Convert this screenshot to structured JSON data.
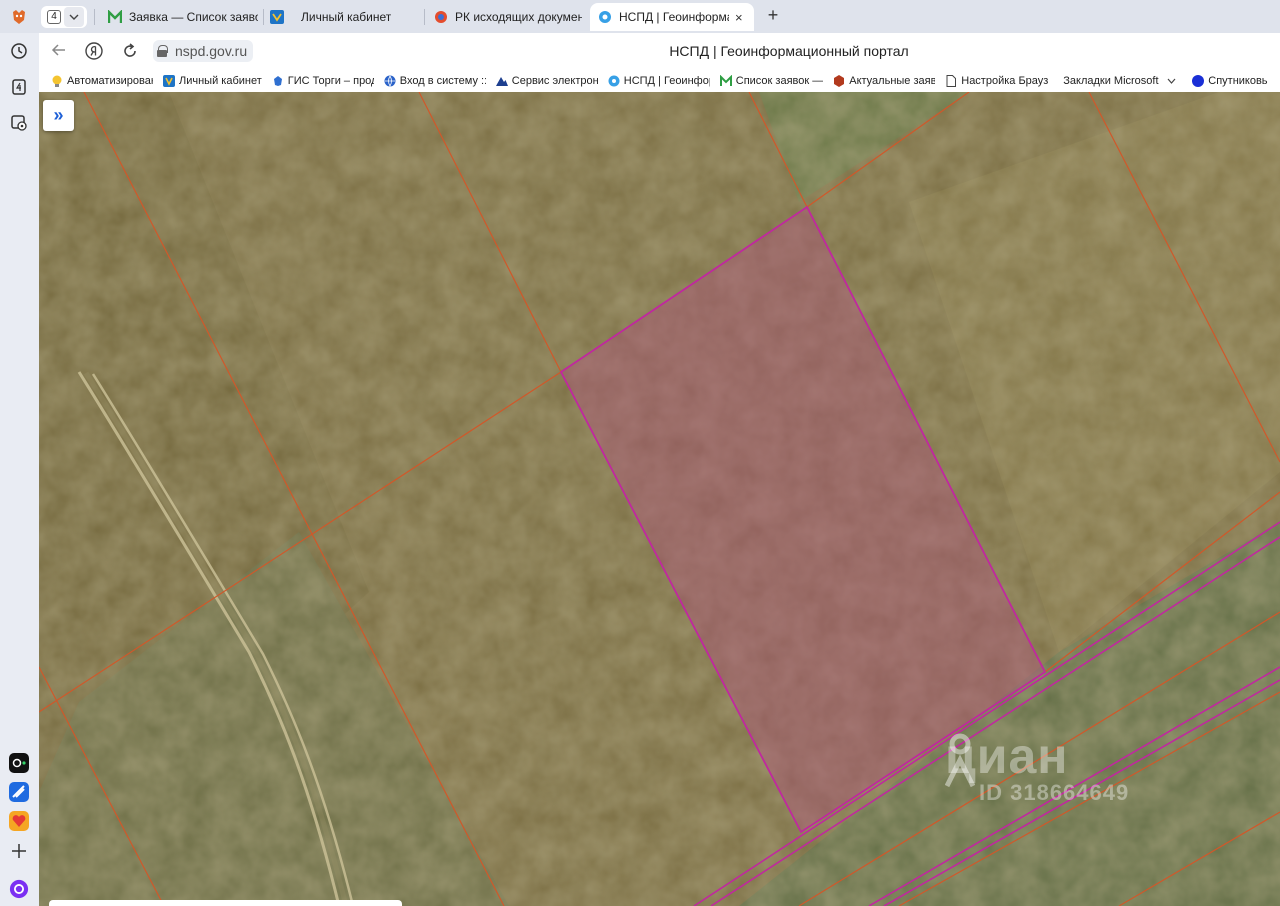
{
  "tab_strip": {
    "tab_count": "4",
    "tabs": [
      {
        "title": "Заявка — Список заявок"
      },
      {
        "title": "Личный кабинет"
      },
      {
        "title": "РК исходящих документов"
      },
      {
        "title": "НСПД | Геоинформаци"
      }
    ],
    "close_glyph": "×",
    "new_tab_glyph": "+"
  },
  "address_bar": {
    "url": "nspd.gov.ru",
    "page_title": "НСПД | Геоинформационный портал"
  },
  "bookmarks": [
    {
      "label": "Автоматизирован",
      "icon": "bulb-icon"
    },
    {
      "label": "Личный кабинет",
      "icon": "emblem-icon"
    },
    {
      "label": "ГИС Торги – прод",
      "icon": "emblem-icon"
    },
    {
      "label": "Вход в систему :: ",
      "icon": "globe-icon"
    },
    {
      "label": "Сервис электрон",
      "icon": "mountain-icon"
    },
    {
      "label": "НСПД | Геоинфор",
      "icon": "nspd-icon"
    },
    {
      "label": "Список заявок —",
      "icon": "m-icon"
    },
    {
      "label": "Актуальные заяв",
      "icon": "box-icon"
    },
    {
      "label": "Настройка Брауз",
      "icon": "page-icon"
    },
    {
      "label": "Закладки Microsoft",
      "icon": "none"
    },
    {
      "label": "Спутниковь",
      "icon": "blue-dot-icon"
    }
  ],
  "map": {
    "expand_glyph": "»",
    "selected_parcel_color": "#c0289f",
    "boundary_color": "#d0582a",
    "watermark_logo": "циан",
    "watermark_id": "ID 318664649"
  }
}
